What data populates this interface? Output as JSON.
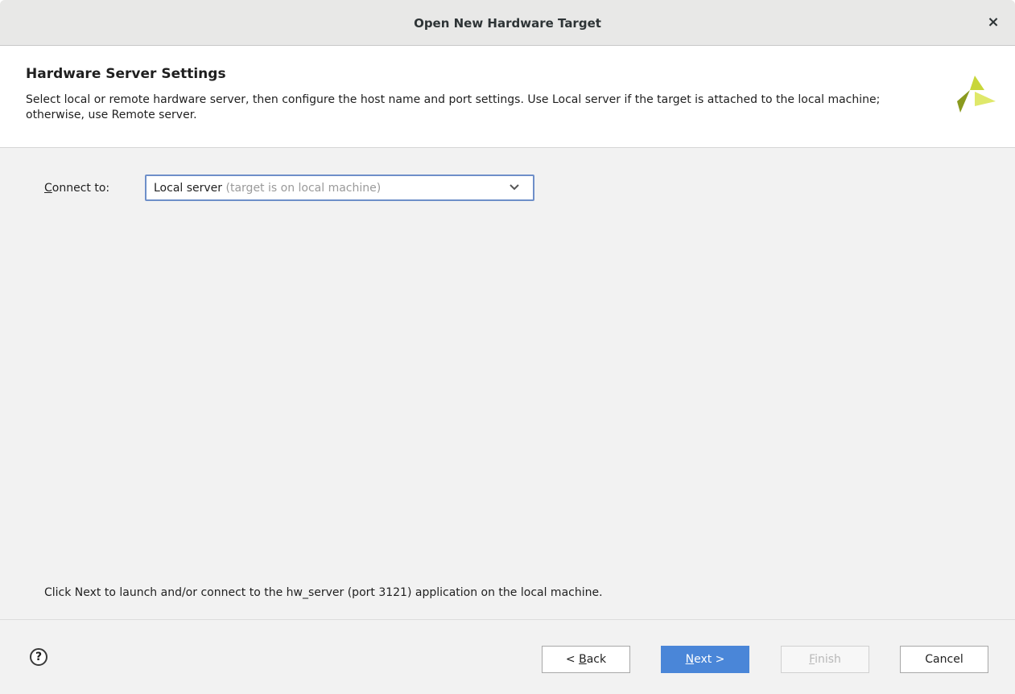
{
  "window": {
    "title": "Open New Hardware Target",
    "close_icon": "×"
  },
  "header": {
    "title": "Hardware Server Settings",
    "description": "Select local or remote hardware server, then configure the host name and port settings. Use Local server if the target is attached to the local machine; otherwise, use Remote server.",
    "logo_icon": "xilinx-logo-icon",
    "logo_colors": [
      "#c8d63a",
      "#8a9a1f",
      "#dfe86a"
    ]
  },
  "connect": {
    "label_mnemonic": "C",
    "label_rest": "onnect to:",
    "selected_value": "Local server",
    "selected_hint": "(target is on local machine)"
  },
  "info": {
    "text": "Click Next to launch and/or connect to the hw_server (port 3121) application on the local machine."
  },
  "footer": {
    "help_label": "?",
    "back": {
      "prefix": "< ",
      "mnemonic": "B",
      "rest": "ack"
    },
    "next": {
      "mnemonic": "N",
      "rest": "ext >"
    },
    "finish": {
      "mnemonic": "F",
      "rest": "inish"
    },
    "cancel_label": "Cancel"
  },
  "colors": {
    "accent": "#4a86d8",
    "combo_border": "#6e8fc9"
  }
}
